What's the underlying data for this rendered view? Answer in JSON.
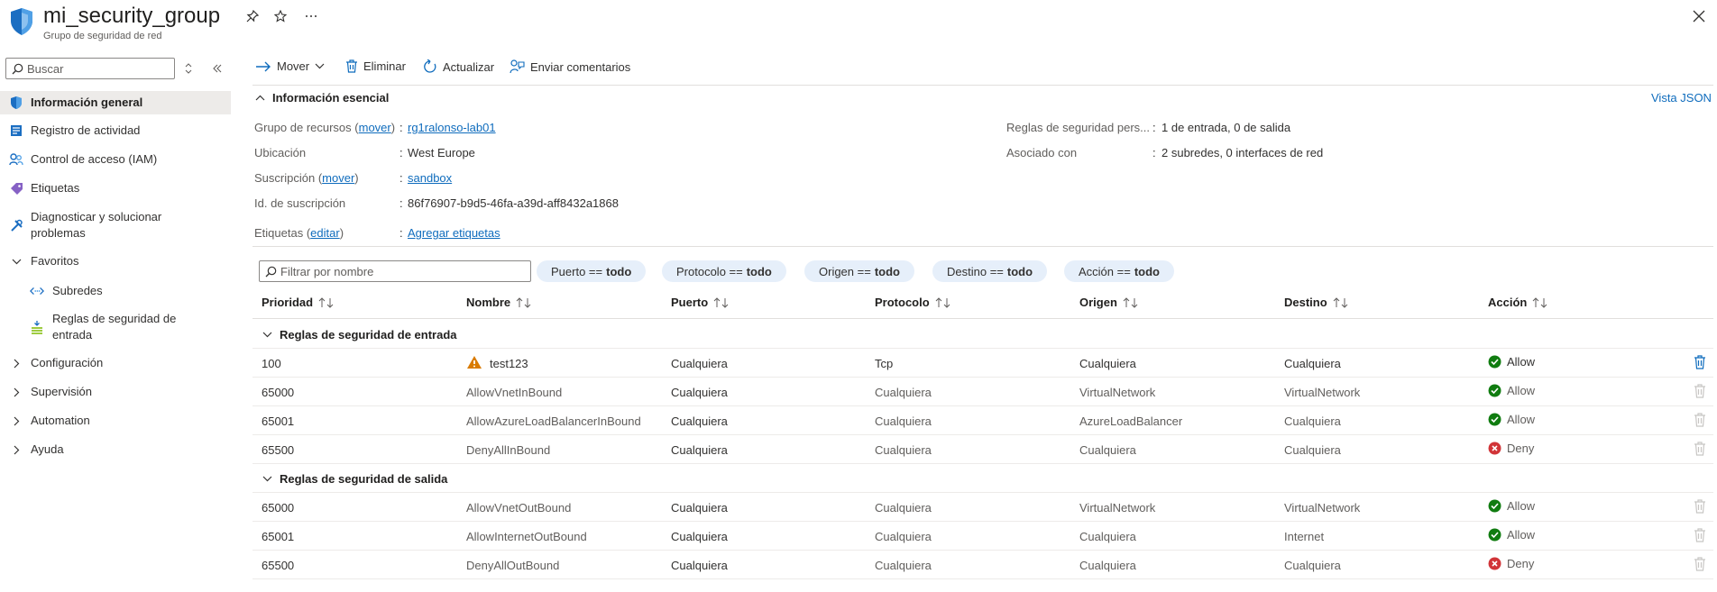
{
  "header": {
    "title": "mi_security_group",
    "subtitle": "Grupo de seguridad de red"
  },
  "sidebar": {
    "search_placeholder": "Buscar",
    "items": [
      {
        "label": "Información general",
        "icon": "shield-icon"
      },
      {
        "label": "Registro de actividad",
        "icon": "activity-log-icon"
      },
      {
        "label": "Control de acceso (IAM)",
        "icon": "people-icon"
      },
      {
        "label": "Etiquetas",
        "icon": "tag-icon"
      },
      {
        "label": "Diagnosticar y solucionar problemas",
        "icon": "wrench-icon"
      },
      {
        "label": "Favoritos",
        "icon": "chevron-down-icon"
      },
      {
        "label": "Subredes",
        "icon": "subnet-icon"
      },
      {
        "label": "Reglas de seguridad de entrada",
        "icon": "inbound-rules-icon"
      },
      {
        "label": "Configuración",
        "icon": "chevron-right-icon"
      },
      {
        "label": "Supervisión",
        "icon": "chevron-right-icon"
      },
      {
        "label": "Automation",
        "icon": "chevron-right-icon"
      },
      {
        "label": "Ayuda",
        "icon": "chevron-right-icon"
      }
    ]
  },
  "toolbar": {
    "move": "Mover",
    "delete": "Eliminar",
    "refresh": "Actualizar",
    "feedback": "Enviar comentarios"
  },
  "essentials": {
    "section_title": "Información esencial",
    "json_view": "Vista JSON",
    "resource_group_label": "Grupo de recursos",
    "resource_group_link": "mover",
    "resource_group_value": "rg1ralonso-lab01",
    "location_label": "Ubicación",
    "location_value": "West Europe",
    "subscription_label": "Suscripción",
    "subscription_link": "mover",
    "subscription_value": "sandbox",
    "subscription_id_label": "Id. de suscripción",
    "subscription_id_value": "86f76907-b9d5-46fa-a39d-aff8432a1868",
    "tags_label": "Etiquetas",
    "tags_link": "editar",
    "tags_value": "Agregar etiquetas",
    "custom_rules_label": "Reglas de seguridad pers...",
    "custom_rules_value": "1 de entrada, 0 de salida",
    "associated_label": "Asociado con",
    "associated_value": "2 subredes, 0 interfaces de red"
  },
  "filters": {
    "placeholder": "Filtrar por nombre",
    "pills": [
      {
        "label": "Puerto ==",
        "value": "todo"
      },
      {
        "label": "Protocolo ==",
        "value": "todo"
      },
      {
        "label": "Origen ==",
        "value": "todo"
      },
      {
        "label": "Destino ==",
        "value": "todo"
      },
      {
        "label": "Acción ==",
        "value": "todo"
      }
    ]
  },
  "table": {
    "columns": [
      "Prioridad",
      "Nombre",
      "Puerto",
      "Protocolo",
      "Origen",
      "Destino",
      "Acción"
    ],
    "groups": [
      {
        "title": "Reglas de seguridad de entrada",
        "rows": [
          {
            "priority": "100",
            "name": "test123",
            "port": "Cualquiera",
            "protocol": "Tcp",
            "source": "Cualquiera",
            "destination": "Cualquiera",
            "action": "Allow",
            "warning": true,
            "custom": true
          },
          {
            "priority": "65000",
            "name": "AllowVnetInBound",
            "port": "Cualquiera",
            "protocol": "Cualquiera",
            "source": "VirtualNetwork",
            "destination": "VirtualNetwork",
            "action": "Allow",
            "warning": false,
            "custom": false
          },
          {
            "priority": "65001",
            "name": "AllowAzureLoadBalancerInBound",
            "port": "Cualquiera",
            "protocol": "Cualquiera",
            "source": "AzureLoadBalancer",
            "destination": "Cualquiera",
            "action": "Allow",
            "warning": false,
            "custom": false
          },
          {
            "priority": "65500",
            "name": "DenyAllInBound",
            "port": "Cualquiera",
            "protocol": "Cualquiera",
            "source": "Cualquiera",
            "destination": "Cualquiera",
            "action": "Deny",
            "warning": false,
            "custom": false
          }
        ]
      },
      {
        "title": "Reglas de seguridad de salida",
        "rows": [
          {
            "priority": "65000",
            "name": "AllowVnetOutBound",
            "port": "Cualquiera",
            "protocol": "Cualquiera",
            "source": "VirtualNetwork",
            "destination": "VirtualNetwork",
            "action": "Allow",
            "warning": false,
            "custom": false
          },
          {
            "priority": "65001",
            "name": "AllowInternetOutBound",
            "port": "Cualquiera",
            "protocol": "Cualquiera",
            "source": "Cualquiera",
            "destination": "Internet",
            "action": "Allow",
            "warning": false,
            "custom": false
          },
          {
            "priority": "65500",
            "name": "DenyAllOutBound",
            "port": "Cualquiera",
            "protocol": "Cualquiera",
            "source": "Cualquiera",
            "destination": "Cualquiera",
            "action": "Deny",
            "warning": false,
            "custom": false
          }
        ]
      }
    ]
  },
  "colors": {
    "accent": "#0f6cbd",
    "allow": "#107c10",
    "deny": "#d13438",
    "warning": "#d97b00"
  }
}
